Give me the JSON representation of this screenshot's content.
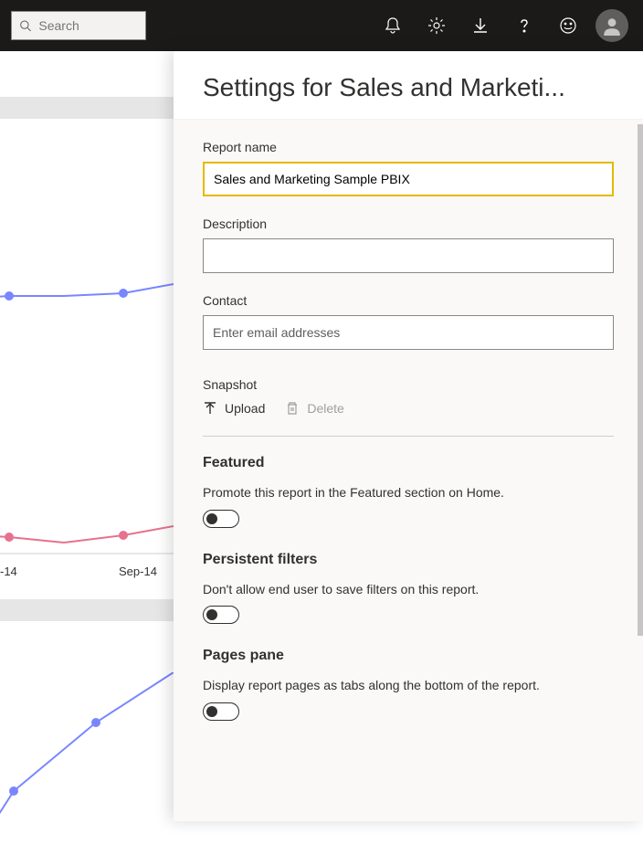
{
  "topbar": {
    "search_placeholder": "Search"
  },
  "panel": {
    "title": "Settings for Sales and Marketi...",
    "report_name_label": "Report name",
    "report_name_value": "Sales and Marketing Sample PBIX",
    "description_label": "Description",
    "description_value": "",
    "contact_label": "Contact",
    "contact_placeholder": "Enter email addresses",
    "snapshot_label": "Snapshot",
    "upload_label": "Upload",
    "delete_label": "Delete",
    "featured": {
      "heading": "Featured",
      "desc": "Promote this report in the Featured section on Home."
    },
    "persistent": {
      "heading": "Persistent filters",
      "desc": "Don't allow end user to save filters on this report."
    },
    "pages": {
      "heading": "Pages pane",
      "desc": "Display report pages as tabs along the bottom of the report."
    }
  },
  "bg_axis": {
    "label1": "-14",
    "label2": "Sep-14"
  }
}
